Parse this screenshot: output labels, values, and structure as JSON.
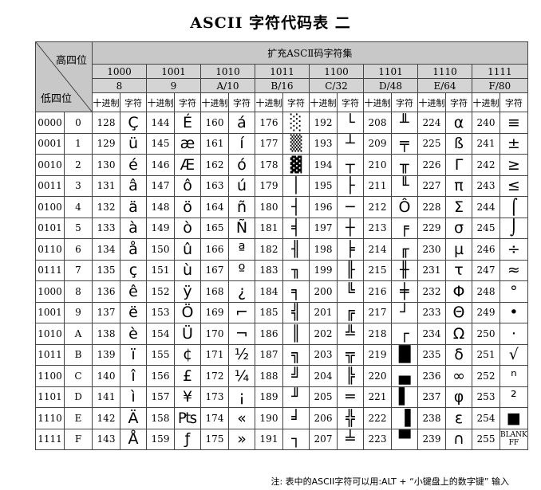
{
  "title": "ASCII 字符代码表 二",
  "corner": {
    "high_label": "高四位",
    "low_label": "低四位"
  },
  "extended_header": "扩充ASCⅡ码字符集",
  "sub_dec": "十进制",
  "sub_char": "字符",
  "columns": [
    {
      "bin": "1000",
      "hex": "8"
    },
    {
      "bin": "1001",
      "hex": "9"
    },
    {
      "bin": "1010",
      "hex": "A/10"
    },
    {
      "bin": "1011",
      "hex": "B/16"
    },
    {
      "bin": "1100",
      "hex": "C/32"
    },
    {
      "bin": "1101",
      "hex": "D/48"
    },
    {
      "bin": "1110",
      "hex": "E/64"
    },
    {
      "bin": "1111",
      "hex": "F/80"
    }
  ],
  "rows": [
    {
      "bin": "0000",
      "hex": "0",
      "chars": [
        "Ç",
        "É",
        "á",
        "░",
        "└",
        "╨",
        "α",
        "≡"
      ]
    },
    {
      "bin": "0001",
      "hex": "1",
      "chars": [
        "ü",
        "æ",
        "í",
        "▒",
        "┴",
        "╤",
        "ß",
        "±"
      ]
    },
    {
      "bin": "0010",
      "hex": "2",
      "chars": [
        "é",
        "Æ",
        "ó",
        "▓",
        "┬",
        "╥",
        "Γ",
        "≥"
      ]
    },
    {
      "bin": "0011",
      "hex": "3",
      "chars": [
        "â",
        "ô",
        "ú",
        "│",
        "├",
        "╙",
        "π",
        "≤"
      ]
    },
    {
      "bin": "0100",
      "hex": "4",
      "chars": [
        "ä",
        "ö",
        "ñ",
        "┤",
        "─",
        "Ô",
        "Σ",
        "⌠"
      ]
    },
    {
      "bin": "0101",
      "hex": "5",
      "chars": [
        "à",
        "ò",
        "Ñ",
        "╡",
        "┼",
        "╒",
        "σ",
        "⌡"
      ]
    },
    {
      "bin": "0110",
      "hex": "6",
      "chars": [
        "å",
        "û",
        "ª",
        "╢",
        "╞",
        "╓",
        "µ",
        "÷"
      ]
    },
    {
      "bin": "0111",
      "hex": "7",
      "chars": [
        "ç",
        "ù",
        "º",
        "╖",
        "╟",
        "╫",
        "τ",
        "≈"
      ]
    },
    {
      "bin": "1000",
      "hex": "8",
      "chars": [
        "ê",
        "ÿ",
        "¿",
        "╕",
        "╚",
        "╪",
        "Φ",
        "°"
      ]
    },
    {
      "bin": "1001",
      "hex": "9",
      "chars": [
        "ë",
        "Ö",
        "⌐",
        "╣",
        "╔",
        "┘",
        "Θ",
        "•"
      ]
    },
    {
      "bin": "1010",
      "hex": "A",
      "chars": [
        "è",
        "Ü",
        "¬",
        "║",
        "╩",
        "┌",
        "Ω",
        "·"
      ]
    },
    {
      "bin": "1011",
      "hex": "B",
      "chars": [
        "ï",
        "¢",
        "½",
        "╗",
        "╦",
        "█",
        "δ",
        "√"
      ]
    },
    {
      "bin": "1100",
      "hex": "C",
      "chars": [
        "î",
        "£",
        "¼",
        "╝",
        "╠",
        "▄",
        "∞",
        "ⁿ"
      ]
    },
    {
      "bin": "1101",
      "hex": "D",
      "chars": [
        "ì",
        "¥",
        "¡",
        "╜",
        "═",
        "▌",
        "φ",
        "²"
      ]
    },
    {
      "bin": "1110",
      "hex": "E",
      "chars": [
        "Ä",
        "₧",
        "«",
        "╛",
        "╬",
        "▐",
        "ε",
        "■"
      ]
    },
    {
      "bin": "1111",
      "hex": "F",
      "chars": [
        "Å",
        "ƒ",
        "»",
        "┐",
        "╧",
        "▀",
        "∩",
        "BLANK FF"
      ]
    }
  ],
  "footnote": "注: 表中的ASCII字符可以用:ALT + “小键盘上的数字键” 输入"
}
